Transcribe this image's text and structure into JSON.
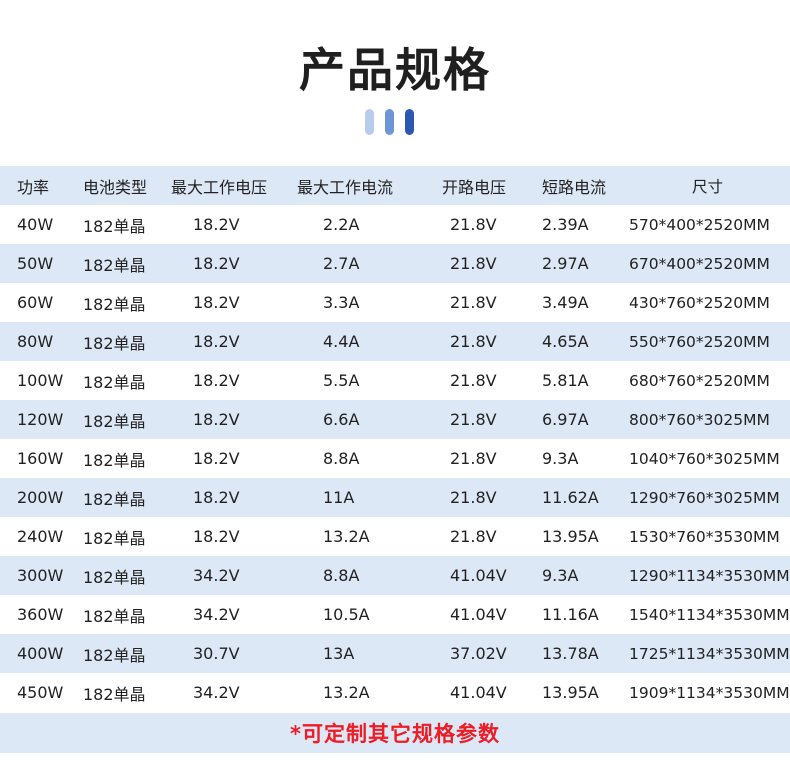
{
  "title": "产品规格",
  "table": {
    "headers": [
      "功率",
      "电池类型",
      "最大工作电压",
      "最大工作电流",
      "开路电压",
      "短路电流",
      "尺寸"
    ],
    "rows": [
      [
        "40W",
        "182单晶",
        "18.2V",
        "2.2A",
        "21.8V",
        "2.39A",
        "570*400*2520MM"
      ],
      [
        "50W",
        "182单晶",
        "18.2V",
        "2.7A",
        "21.8V",
        "2.97A",
        "670*400*2520MM"
      ],
      [
        "60W",
        "182单晶",
        "18.2V",
        "3.3A",
        "21.8V",
        "3.49A",
        "430*760*2520MM"
      ],
      [
        "80W",
        "182单晶",
        "18.2V",
        "4.4A",
        "21.8V",
        "4.65A",
        "550*760*2520MM"
      ],
      [
        "100W",
        "182单晶",
        "18.2V",
        "5.5A",
        "21.8V",
        "5.81A",
        "680*760*2520MM"
      ],
      [
        "120W",
        "182单晶",
        "18.2V",
        "6.6A",
        "21.8V",
        "6.97A",
        "800*760*3025MM"
      ],
      [
        "160W",
        "182单晶",
        "18.2V",
        "8.8A",
        "21.8V",
        "9.3A",
        "1040*760*3025MM"
      ],
      [
        "200W",
        "182单晶",
        "18.2V",
        "11A",
        "21.8V",
        "11.62A",
        "1290*760*3025MM"
      ],
      [
        "240W",
        "182单晶",
        "18.2V",
        "13.2A",
        "21.8V",
        "13.95A",
        "1530*760*3530MM"
      ],
      [
        "300W",
        "182单晶",
        "34.2V",
        "8.8A",
        "41.04V",
        "9.3A",
        "1290*1134*3530MM"
      ],
      [
        "360W",
        "182单晶",
        "34.2V",
        "10.5A",
        "41.04V",
        "11.16A",
        "1540*1134*3530MM"
      ],
      [
        "400W",
        "182单晶",
        "30.7V",
        "13A",
        "37.02V",
        "13.78A",
        "1725*1134*3530MM"
      ],
      [
        "450W",
        "182单晶",
        "34.2V",
        "13.2A",
        "41.04V",
        "13.95A",
        "1909*1134*3530MM"
      ]
    ]
  },
  "footer_note": "*可定制其它规格参数",
  "colors": {
    "stripe": "#dde8f7",
    "accent_dark": "#2c58b4",
    "accent_mid": "#6e95d6",
    "accent_light": "#b8cdee",
    "note": "#ee1c25"
  }
}
